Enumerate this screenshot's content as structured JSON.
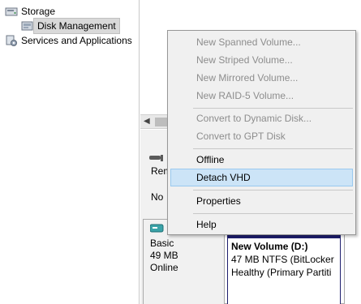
{
  "tree": {
    "storage_label": "Storage",
    "disk_management_label": "Disk Management",
    "services_label": "Services and Applications"
  },
  "disk_list": {
    "row1_text": "Rem",
    "row2_text": "No"
  },
  "disk_panel": {
    "type": "Basic",
    "size": "49 MB",
    "status": "Online"
  },
  "volume": {
    "name": "New Volume  (D:)",
    "details": "47 MB NTFS (BitLocker",
    "health": "Healthy (Primary Partiti"
  },
  "context_menu": {
    "new_spanned": "New Spanned Volume...",
    "new_striped": "New Striped Volume...",
    "new_mirrored": "New Mirrored Volume...",
    "new_raid5": "New RAID-5 Volume...",
    "convert_dynamic": "Convert to Dynamic Disk...",
    "convert_gpt": "Convert to GPT Disk",
    "offline": "Offline",
    "detach_vhd": "Detach VHD",
    "properties": "Properties",
    "help": "Help"
  },
  "colors": {
    "menu_bg": "#f0f0f0",
    "menu_hover": "#cce4f7",
    "disabled_text": "#8d8d8d",
    "volume_header": "#1e1e6e"
  }
}
